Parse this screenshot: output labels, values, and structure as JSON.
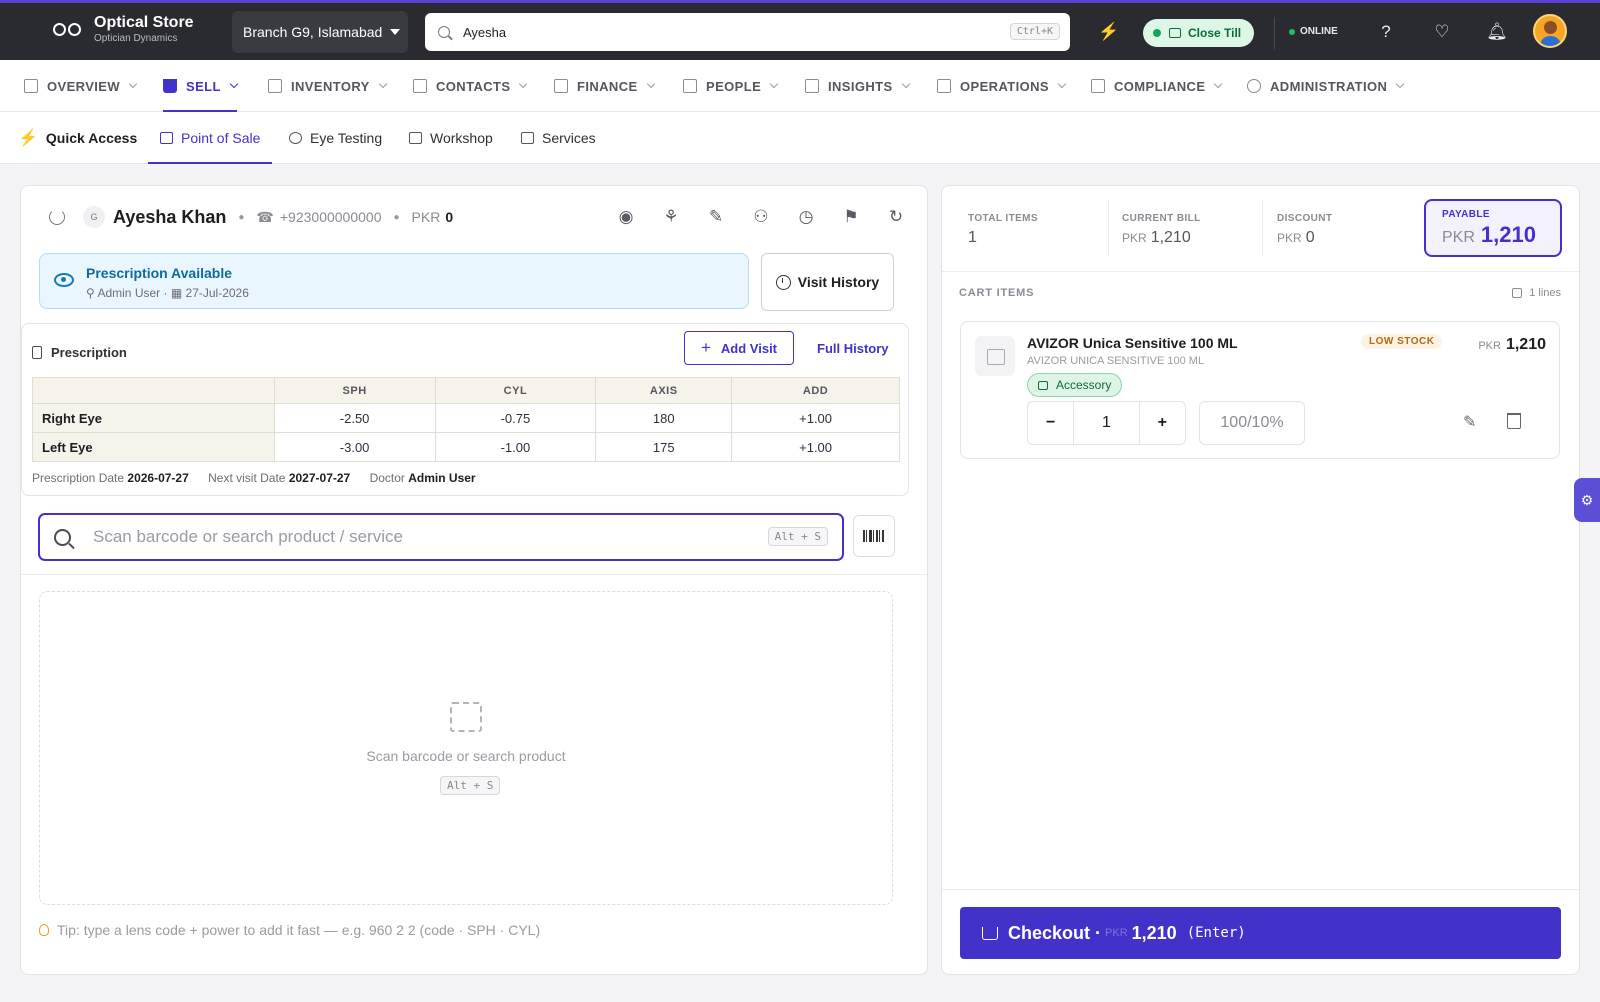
{
  "header": {
    "brand_name": "Optical Store",
    "brand_sub": "Optician Dynamics",
    "branch": "Branch G9, Islamabad",
    "search_value": "Ayesha",
    "search_shortcut": "Ctrl+K",
    "close_till": "Close Till",
    "status": "ONLINE",
    "icons": [
      "bolt-icon",
      "help-icon",
      "heartbeat-icon",
      "bell-icon",
      "user-avatar"
    ]
  },
  "main_nav": [
    {
      "label": "OVERVIEW",
      "icon": "dashboard-icon"
    },
    {
      "label": "SELL",
      "icon": "cart-icon",
      "active": true
    },
    {
      "label": "INVENTORY",
      "icon": "box-icon"
    },
    {
      "label": "CONTACTS",
      "icon": "users-icon"
    },
    {
      "label": "FINANCE",
      "icon": "cash-icon"
    },
    {
      "label": "PEOPLE",
      "icon": "badge-icon"
    },
    {
      "label": "INSIGHTS",
      "icon": "chart-icon"
    },
    {
      "label": "OPERATIONS",
      "icon": "briefcase-icon"
    },
    {
      "label": "COMPLIANCE",
      "icon": "clipboard-icon"
    },
    {
      "label": "ADMINISTRATION",
      "icon": "gear-icon"
    }
  ],
  "sub_nav": {
    "quick_access": "Quick Access",
    "items": [
      {
        "label": "Point of Sale",
        "icon": "register-icon",
        "active": true
      },
      {
        "label": "Eye Testing",
        "icon": "glasses-icon"
      },
      {
        "label": "Workshop",
        "icon": "tools-icon"
      },
      {
        "label": "Services",
        "icon": "service-icon"
      }
    ]
  },
  "customer": {
    "initial": "G",
    "name": "Ayesha Khan",
    "phone": "+923000000000",
    "balance_currency": "PKR",
    "balance": "0"
  },
  "prescription_banner": {
    "title": "Prescription Available",
    "user": "Admin User",
    "date": "27-Jul-2026",
    "visit_history": "Visit History"
  },
  "prescription": {
    "label": "Prescription",
    "add_visit": "Add Visit",
    "full_history": "Full History",
    "columns": [
      "SPH",
      "CYL",
      "AXIS",
      "ADD"
    ],
    "rows": [
      {
        "eye": "Right Eye",
        "sph": "-2.50",
        "cyl": "-0.75",
        "axis": "180",
        "add": "+1.00"
      },
      {
        "eye": "Left Eye",
        "sph": "-3.00",
        "cyl": "-1.00",
        "axis": "175",
        "add": "+1.00"
      }
    ],
    "rx_date_label": "Prescription Date",
    "rx_date": "2026-07-27",
    "next_visit_label": "Next visit Date",
    "next_visit": "2027-07-27",
    "doctor_label": "Doctor",
    "doctor": "Admin User"
  },
  "product_search": {
    "placeholder": "Scan barcode or search product / service",
    "shortcut": "Alt + S",
    "empty_text": "Scan barcode or search product",
    "empty_shortcut": "Alt + S"
  },
  "tip": "Tip: type a lens code + power to add it fast — e.g. 960 2 2 (code · SPH · CYL)",
  "summary": {
    "total_items_label": "TOTAL ITEMS",
    "total_items": "1",
    "current_bill_label": "CURRENT BILL",
    "current_bill": "1,210",
    "discount_label": "DISCOUNT",
    "discount": "0",
    "payable_label": "PAYABLE",
    "payable": "1,210",
    "currency": "PKR"
  },
  "cart": {
    "label": "CART ITEMS",
    "lines": "1 lines",
    "items": [
      {
        "name": "AVIZOR Unica Sensitive 100 ML",
        "sub": "AVIZOR UNICA SENSITIVE 100 ML",
        "tag": "Accessory",
        "stock": "LOW STOCK",
        "currency": "PKR",
        "price": "1,210",
        "qty": "1",
        "discount": "100/10%"
      }
    ]
  },
  "checkout": {
    "label": "Checkout ·",
    "currency": "PKR",
    "amount": "1,210",
    "hint": "(Enter)"
  },
  "colors": {
    "accent": "#4332c9",
    "topbar": "#2a2b30",
    "success": "#14a55b"
  }
}
